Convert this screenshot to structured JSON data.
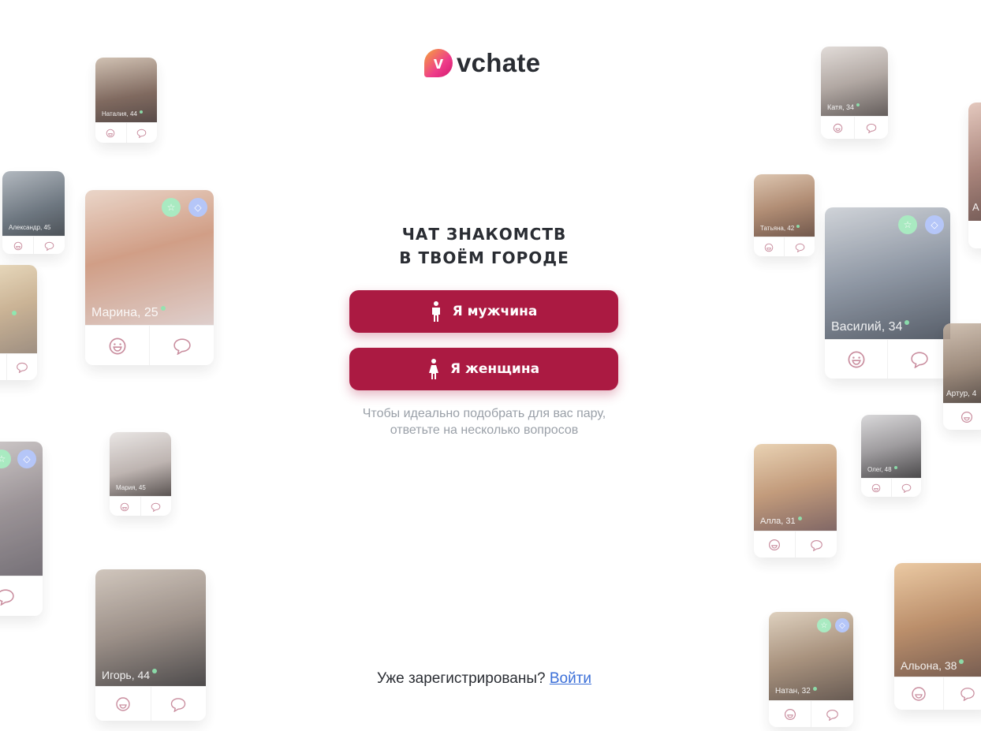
{
  "brand": {
    "logo_letter": "v",
    "name": "vchate"
  },
  "hero": {
    "title_line1": "ЧАТ ЗНАКОМСТВ",
    "title_line2": "В ТВОЁМ ГОРОДЕ"
  },
  "buttons": {
    "male": "Я мужчина",
    "female": "Я женщина"
  },
  "hint": {
    "line1": "Чтобы идеально подобрать для вас пару,",
    "line2": "ответьте на несколько вопросов"
  },
  "login": {
    "question": "Уже зарегистрированы? ",
    "link": "Войти"
  },
  "profiles": {
    "natalia": "Наталия, 44",
    "alexandr": "Александр, 45",
    "marina25": "Марина, 25",
    "maria": "Мария, 45",
    "igor": "Игорь, 44",
    "katya": "Катя, 34",
    "tatiana": "Татьяна, 42",
    "vasily": "Василий, 34",
    "artur": "Артур, 4",
    "oleg": "Олег, 48",
    "alla": "Алла, 31",
    "natan": "Натан, 32",
    "alyona": "Альона, 38",
    "partial_a": "А"
  },
  "colors": {
    "accent": "#ab1a42",
    "link": "#3b6fd8",
    "online": "#7be3a3",
    "icon": "#c07a8e"
  }
}
